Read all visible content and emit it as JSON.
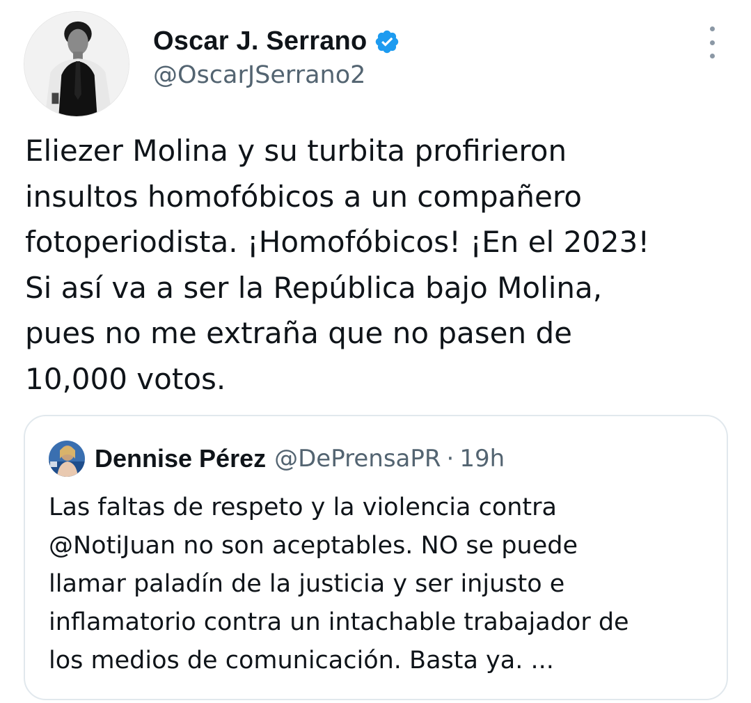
{
  "author": {
    "display_name": "Oscar J. Serrano",
    "handle": "@OscarJSerrano2",
    "verified": true,
    "avatar_icon": "profile-photo-man-in-vest"
  },
  "tweet": {
    "text_lines": [
      "Eliezer Molina y su turbita profirieron",
      "insultos homofóbicos a un compañero",
      "fotoperiodista. ¡Homofóbicos! ¡En el 2023!",
      "Si así va a ser la República bajo Molina,",
      "pues no me extraña que no pasen de",
      "10,000 votos."
    ]
  },
  "quoted_tweet": {
    "display_name": "Dennise Pérez",
    "handle": "@DePrensaPR",
    "separator": "·",
    "time": "19h",
    "avatar_icon": "profile-photo-woman",
    "text_lines": [
      "Las faltas de respeto y la violencia contra",
      "@NotiJuan no son aceptables. NO se puede",
      "llamar paladín de la justicia y ser injusto e",
      "inflamatorio contra un intachable trabajador de",
      "los medios de comunicación. Basta ya. ..."
    ]
  },
  "colors": {
    "text_primary": "#0f1419",
    "text_secondary": "#536471",
    "verified_blue": "#1d9bf0",
    "border": "#e1e8ed"
  },
  "icons": {
    "verified": "verified-badge-icon",
    "more": "more-options-icon"
  }
}
